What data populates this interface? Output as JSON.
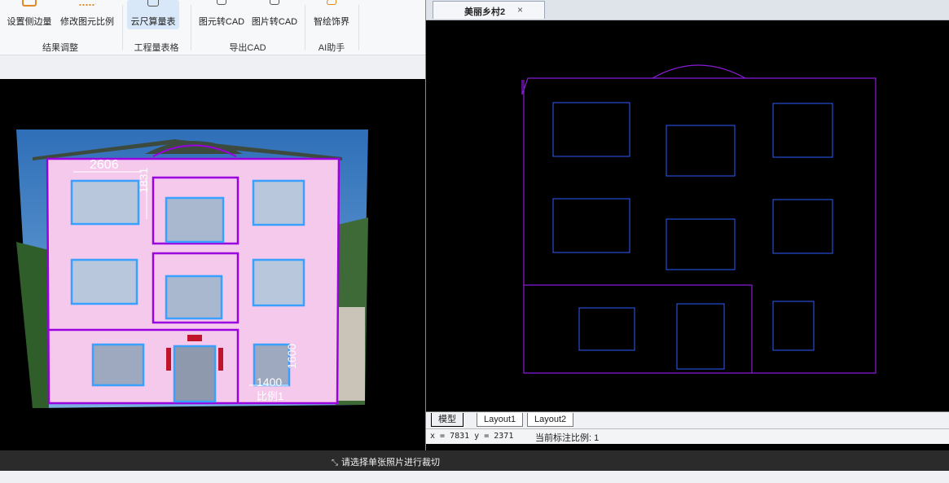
{
  "ribbon": {
    "groups": [
      {
        "label": "结果调整",
        "buttons": [
          "设置侧边量",
          "修改图元比例"
        ]
      },
      {
        "label": "工程量表格",
        "buttons": [
          "云尺算量表"
        ]
      },
      {
        "label": "导出CAD",
        "buttons": [
          "图元转CAD",
          "图片转CAD"
        ]
      },
      {
        "label": "AI助手",
        "buttons": [
          "智绘饰界"
        ]
      }
    ]
  },
  "photo": {
    "dim_top": "2606",
    "dim_vertical_left": "1831",
    "dim_vertical_right": "1600",
    "dim_bottom": "1400",
    "scale_label": "比例1"
  },
  "cad": {
    "tab_title": "美丽乡村2",
    "tab_close": "×",
    "layout_tabs": [
      "模型",
      "Layout1",
      "Layout2"
    ],
    "coord_readout": "x = 7831  y = 2371",
    "scale_text": "当前标注比例: 1"
  },
  "bottom": {
    "crop_hint": "请选择单张照片进行裁切"
  },
  "colors": {
    "overlay_purple": "#9b00e0",
    "window_blue": "#3aa0ff",
    "cad_blue": "#2c5bff",
    "cad_purple": "#8a1bd6"
  }
}
